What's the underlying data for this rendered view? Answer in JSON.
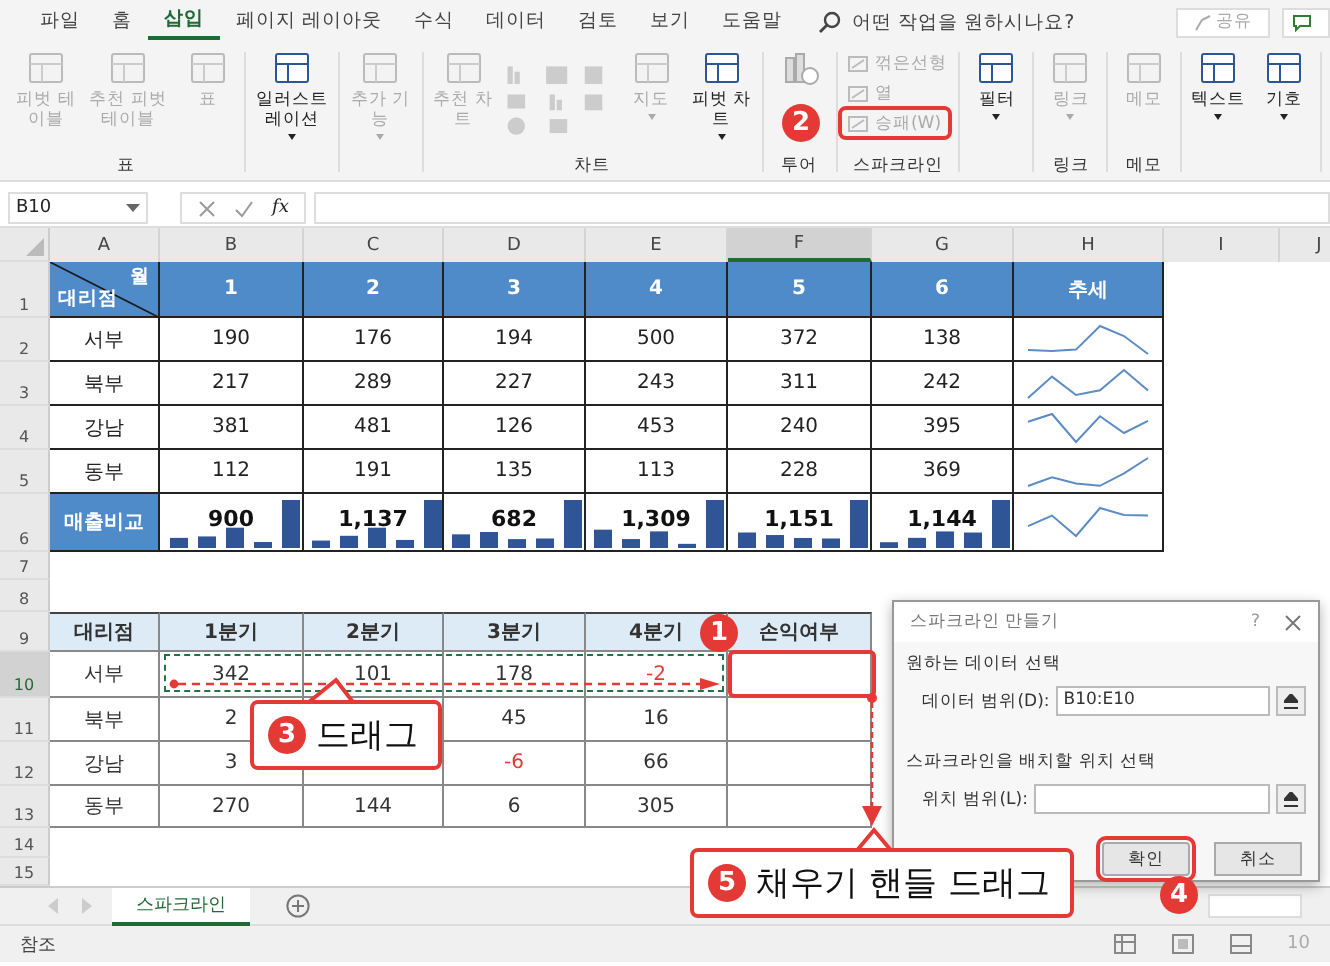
{
  "menu_tabs": [
    {
      "label": "파일",
      "selected": false
    },
    {
      "label": "홈",
      "selected": false
    },
    {
      "label": "삽입",
      "selected": true
    },
    {
      "label": "페이지 레이아웃",
      "selected": false
    },
    {
      "label": "수식",
      "selected": false
    },
    {
      "label": "데이터",
      "selected": false
    },
    {
      "label": "검토",
      "selected": false
    },
    {
      "label": "보기",
      "selected": false
    },
    {
      "label": "도움말",
      "selected": false
    }
  ],
  "search": {
    "placeholder": "어떤 작업을 원하시나요?"
  },
  "share_button": "공유",
  "ribbon": [
    {
      "label": "표",
      "items": [
        {
          "kind": "large",
          "label": "피벗 테이블",
          "disabled": true,
          "menu": false
        },
        {
          "kind": "large",
          "label": "추천 피벗 테이블",
          "disabled": true,
          "menu": false
        },
        {
          "kind": "large",
          "label": "표",
          "disabled": true,
          "menu": false
        }
      ]
    },
    {
      "items": [
        {
          "kind": "large",
          "label": "일러스트레이션",
          "disabled": false,
          "menu": true
        }
      ]
    },
    {
      "items": [
        {
          "kind": "large",
          "label": "추가 기능",
          "disabled": true,
          "menu": true
        }
      ]
    },
    {
      "label": "차트",
      "items": [
        {
          "kind": "large",
          "label": "추천 차트",
          "disabled": true,
          "menu": false
        },
        {
          "kind": "chart_icons"
        },
        {
          "kind": "large",
          "label": "지도",
          "disabled": true,
          "menu": true
        },
        {
          "kind": "large",
          "label": "피벗 차트",
          "disabled": false,
          "menu": true
        }
      ]
    },
    {
      "label": "투어",
      "items": [
        {
          "kind": "icon_only",
          "disabled": true
        }
      ]
    },
    {
      "label": "스파크라인",
      "items": [
        {
          "kind": "small",
          "label": "꺾은선형",
          "disabled": true,
          "annotated": false
        },
        {
          "kind": "small",
          "label": "열",
          "disabled": true,
          "annotated": false
        },
        {
          "kind": "small",
          "label": "승패(W)",
          "disabled": true,
          "annotated": true
        }
      ]
    },
    {
      "items": [
        {
          "kind": "large",
          "label": "필터",
          "disabled": false,
          "menu": true
        }
      ]
    },
    {
      "label": "링크",
      "items": [
        {
          "kind": "large",
          "label": "링크",
          "disabled": true,
          "menu": true
        }
      ]
    },
    {
      "label": "메모",
      "items": [
        {
          "kind": "large",
          "label": "메모",
          "disabled": true,
          "menu": false
        }
      ]
    },
    {
      "items": [
        {
          "kind": "large",
          "label": "텍스트",
          "disabled": false,
          "menu": true
        },
        {
          "kind": "large",
          "label": "기호",
          "disabled": false,
          "menu": true
        }
      ]
    }
  ],
  "formula_bar": {
    "name_box": "B10",
    "function_label": "fx"
  },
  "sheet": {
    "columns": [
      {
        "label": "A",
        "selected": false
      },
      {
        "label": "B",
        "selected": false
      },
      {
        "label": "C",
        "selected": false
      },
      {
        "label": "D",
        "selected": false
      },
      {
        "label": "E",
        "selected": false
      },
      {
        "label": "F",
        "selected": true
      },
      {
        "label": "G",
        "selected": false
      },
      {
        "label": "H",
        "selected": false
      },
      {
        "label": "I",
        "selected": false
      },
      {
        "label": "J",
        "selected": false
      }
    ],
    "rows": [
      {
        "label": "1",
        "selected": false
      },
      {
        "label": "2",
        "selected": false
      },
      {
        "label": "3",
        "selected": false
      },
      {
        "label": "4",
        "selected": false
      },
      {
        "label": "5",
        "selected": false
      },
      {
        "label": "6",
        "selected": false
      },
      {
        "label": "7",
        "selected": false
      },
      {
        "label": "8",
        "selected": false
      },
      {
        "label": "9",
        "selected": false
      },
      {
        "label": "10",
        "selected": true
      },
      {
        "label": "11",
        "selected": false
      },
      {
        "label": "12",
        "selected": false
      },
      {
        "label": "13",
        "selected": false
      },
      {
        "label": "14",
        "selected": false
      },
      {
        "label": "15",
        "selected": false
      }
    ],
    "upper_table": {
      "corner_top": "월",
      "corner_bottom": "대리점",
      "months": [
        "1",
        "2",
        "3",
        "4",
        "5",
        "6"
      ],
      "trend_header": "추세",
      "rows": [
        {
          "name": "서부",
          "values": [
            "190",
            "176",
            "194",
            "500",
            "372",
            "138"
          ]
        },
        {
          "name": "북부",
          "values": [
            "217",
            "289",
            "227",
            "243",
            "311",
            "242"
          ]
        },
        {
          "name": "강남",
          "values": [
            "381",
            "481",
            "126",
            "453",
            "240",
            "395"
          ]
        },
        {
          "name": "동부",
          "values": [
            "112",
            "191",
            "135",
            "113",
            "228",
            "369"
          ]
        }
      ],
      "total_row": {
        "name": "매출비교",
        "totals": [
          "900",
          "1,137",
          "682",
          "1,309",
          "1,151",
          "1,144"
        ]
      }
    },
    "lower_table": {
      "headers": [
        "대리점",
        "1분기",
        "2분기",
        "3분기",
        "4분기",
        "손익여부"
      ],
      "rows": [
        {
          "name": "서부",
          "values": {
            "q1": "342",
            "q2": "101",
            "q3": "178",
            "q4": "-2"
          }
        },
        {
          "name": "북부",
          "values": {
            "q1": "2",
            "q3": "45",
            "q4": "16"
          }
        },
        {
          "name": "강남",
          "values": {
            "q1": "3",
            "q3": "-6",
            "q4": "66"
          }
        },
        {
          "name": "동부",
          "values": {
            "q1": "270",
            "q2": "144",
            "q3": "6",
            "q4": "305"
          }
        }
      ]
    }
  },
  "sheet_tabs": [
    {
      "label": "스파크라인",
      "selected": true
    }
  ],
  "status_bar": {
    "text": "참조",
    "zoom": "10"
  },
  "dialog": {
    "title": "스파크라인 만들기",
    "help": "?",
    "section_1": "원하는 데이터 선택",
    "data_range_label": "데이터 범위(D):",
    "data_range_value": "B10:E10",
    "section_2": "스파크라인을 배치할 위치 선택",
    "location_label": "위치 범위(L):",
    "buttons": [
      {
        "label": "확인",
        "annotated": true
      },
      {
        "label": "취소",
        "annotated": false
      }
    ]
  },
  "annotations": {
    "markers": [
      "2",
      "1",
      "4"
    ],
    "callouts": [
      {
        "number": "3",
        "text": "드래그"
      },
      {
        "number": "5",
        "text": "채우기 핸들 드래그"
      }
    ]
  }
}
